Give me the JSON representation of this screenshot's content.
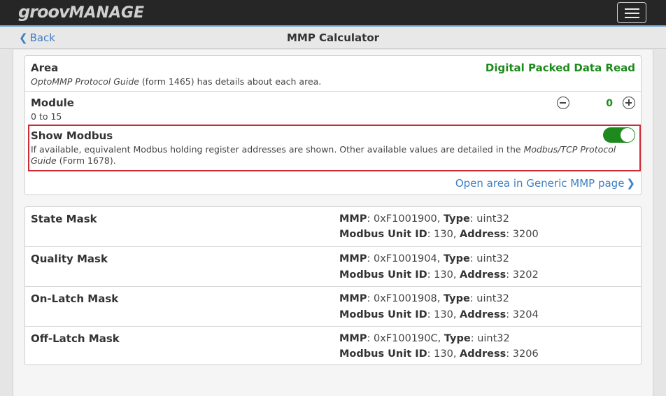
{
  "app": {
    "logo_part1": "groov",
    "logo_part2": "MANAGE",
    "menu_icon": "hamburger-icon"
  },
  "header": {
    "back_label": "Back",
    "title": "MMP Calculator"
  },
  "settings": {
    "area": {
      "label": "Area",
      "guide_italic": "OptoMMP Protocol Guide",
      "guide_rest": " (form 1465) has details about each area.",
      "value": "Digital Packed Data Read"
    },
    "module": {
      "label": "Module",
      "range": "0 to 15",
      "value": "0"
    },
    "show_modbus": {
      "label": "Show Modbus",
      "desc_part1": "If available, equivalent Modbus holding register addresses are shown. Other available values are detailed in the ",
      "desc_italic": "Modbus/TCP Protocol Guide",
      "desc_part2": " (Form 1678).",
      "enabled": true
    },
    "open_link": "Open area in Generic MMP page"
  },
  "registers": {
    "mmp_label": "MMP",
    "type_label": "Type",
    "unit_label": "Modbus Unit ID",
    "address_label": "Address",
    "items": [
      {
        "name": "State Mask",
        "mmp": "0xF1001900",
        "type": "uint32",
        "unit": "130",
        "address": "3200"
      },
      {
        "name": "Quality Mask",
        "mmp": "0xF1001904",
        "type": "uint32",
        "unit": "130",
        "address": "3202"
      },
      {
        "name": "On-Latch Mask",
        "mmp": "0xF1001908",
        "type": "uint32",
        "unit": "130",
        "address": "3204"
      },
      {
        "name": "Off-Latch Mask",
        "mmp": "0xF100190C",
        "type": "uint32",
        "unit": "130",
        "address": "3206"
      }
    ]
  },
  "colors": {
    "accent_green": "#1e8a1e",
    "link_blue": "#3c7fc2",
    "highlight_red": "#cc2b35",
    "topbar": "#262626"
  }
}
